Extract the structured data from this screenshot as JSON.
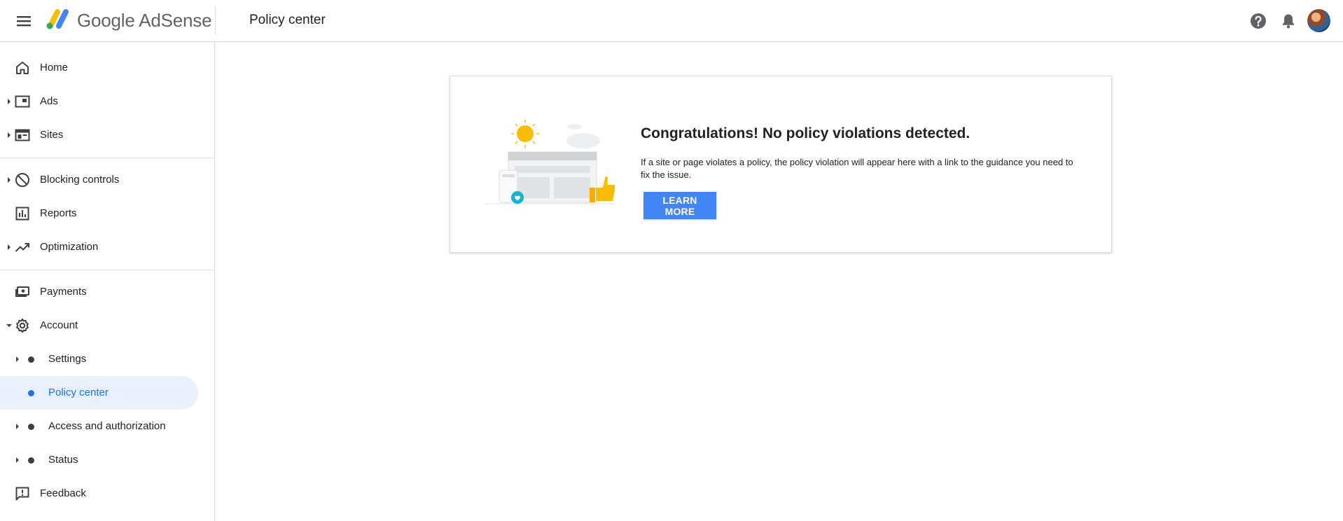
{
  "header": {
    "brand_prefix": "Google",
    "brand_suffix": "AdSense",
    "page_title": "Policy center"
  },
  "icons": {
    "menu": "menu-icon",
    "logo": "adsense-logo-icon",
    "help": "help-icon",
    "notifications": "bell-icon",
    "avatar": "avatar"
  },
  "sidebar": {
    "items": [
      {
        "label": "Home",
        "icon": "home-icon",
        "expandable": false
      },
      {
        "label": "Ads",
        "icon": "ads-icon",
        "expandable": true
      },
      {
        "label": "Sites",
        "icon": "sites-icon",
        "expandable": true
      },
      {
        "label": "Blocking controls",
        "icon": "block-icon",
        "expandable": true
      },
      {
        "label": "Reports",
        "icon": "reports-icon",
        "expandable": false
      },
      {
        "label": "Optimization",
        "icon": "trending-icon",
        "expandable": true
      },
      {
        "label": "Payments",
        "icon": "payments-icon",
        "expandable": false
      },
      {
        "label": "Account",
        "icon": "gear-icon",
        "expandable": true,
        "expanded": true
      },
      {
        "label": "Settings",
        "icon": "dot",
        "expandable": true
      },
      {
        "label": "Policy center",
        "icon": "dot",
        "expandable": false,
        "active": true
      },
      {
        "label": "Access and authorization",
        "icon": "dot",
        "expandable": true
      },
      {
        "label": "Status",
        "icon": "dot",
        "expandable": true
      },
      {
        "label": "Feedback",
        "icon": "feedback-icon",
        "expandable": false
      }
    ]
  },
  "main": {
    "card": {
      "title": "Congratulations! No policy violations detected.",
      "description": "If a site or page violates a policy, the policy violation will appear here with a link to the guidance you need to fix the issue.",
      "button_label": "LEARN MORE"
    }
  },
  "colors": {
    "accent": "#1a73e8",
    "button": "#4285f4",
    "active_bg": "#e8f0fe",
    "divider": "#dadce0"
  }
}
